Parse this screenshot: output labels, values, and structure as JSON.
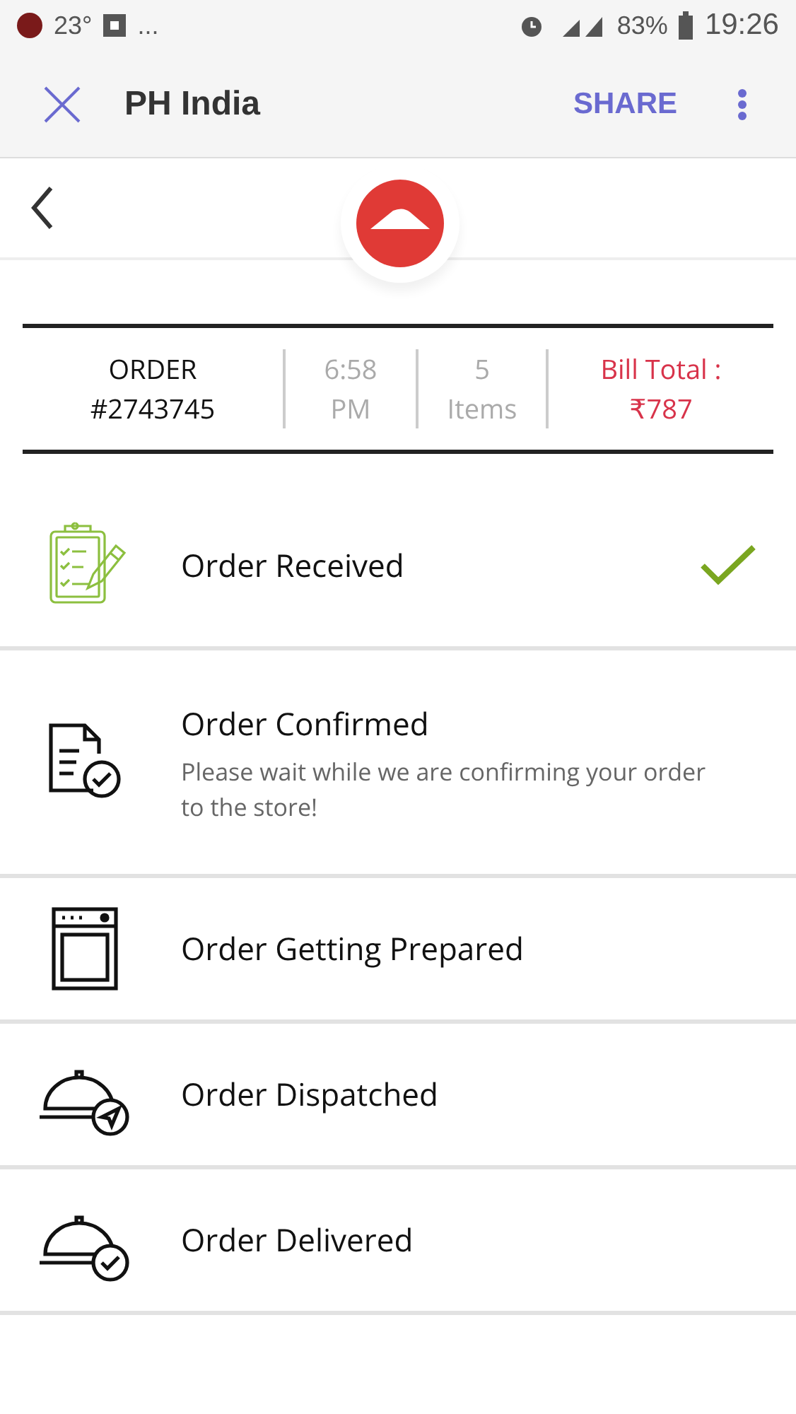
{
  "status_bar": {
    "temperature": "23°",
    "more": "...",
    "battery": "83%",
    "time": "19:26"
  },
  "toolbar": {
    "title": "PH India",
    "action": "SHARE"
  },
  "summary": {
    "order_label": "ORDER",
    "order_number": "#2743745",
    "time": "6:58",
    "period": "PM",
    "count": "5",
    "count_label": "Items",
    "bill_label": "Bill Total :",
    "bill_amount": "₹787"
  },
  "steps": [
    {
      "kind": "clipboard",
      "title": "Order Received",
      "done": true
    },
    {
      "kind": "document",
      "title": "Order Confirmed",
      "subtitle": "Please wait while we are confirming your order to the store!",
      "done": false
    },
    {
      "kind": "oven",
      "title": "Order Getting Prepared",
      "done": false
    },
    {
      "kind": "dispatch",
      "title": "Order Dispatched",
      "done": false
    },
    {
      "kind": "delivered",
      "title": "Order Delivered",
      "done": false
    }
  ]
}
